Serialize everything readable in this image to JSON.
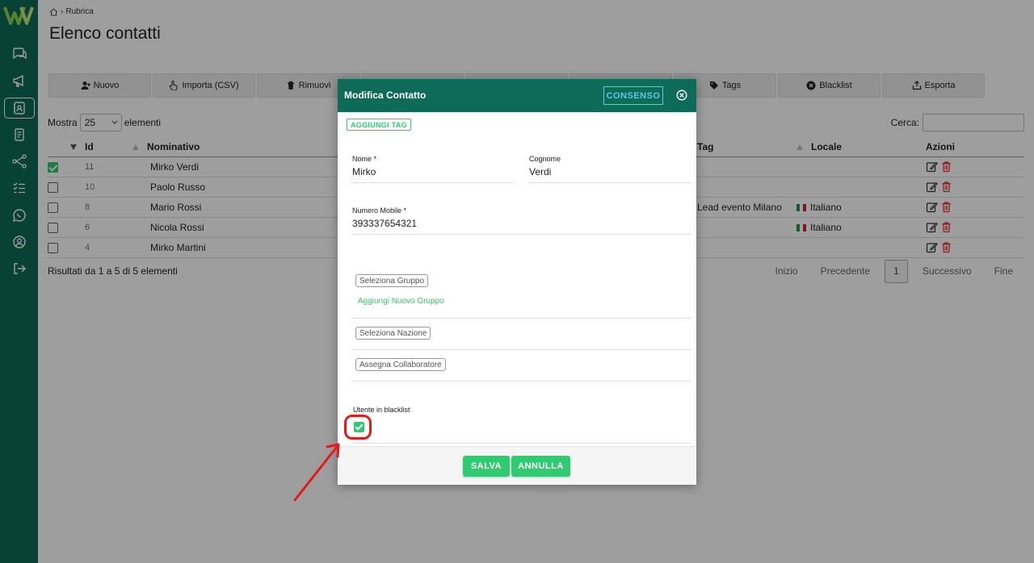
{
  "breadcrumb": {
    "label": "Rubrica"
  },
  "page": {
    "title": "Elenco contatti"
  },
  "toolbar": {
    "buttons": [
      {
        "label": "Nuovo",
        "icon": "user-plus-icon"
      },
      {
        "label": "Importa (CSV)",
        "icon": "hand-pointer-icon"
      },
      {
        "label": "Rimuovi",
        "icon": "trash-icon"
      },
      {
        "label": "",
        "icon": ""
      },
      {
        "label": "",
        "icon": ""
      },
      {
        "label": "",
        "icon": ""
      },
      {
        "label": "Tags",
        "icon": "tag-icon"
      },
      {
        "label": "Blacklist",
        "icon": "x-circle-icon"
      },
      {
        "label": "Esporta",
        "icon": "export-icon"
      }
    ]
  },
  "table_controls": {
    "show_label": "Mostra",
    "show_value": "25",
    "elements_label": "elementi",
    "search_label": "Cerca:"
  },
  "table": {
    "columns": [
      "Id",
      "Nominativo",
      "Tag",
      "Locale",
      "Azioni"
    ],
    "rows": [
      {
        "checked": true,
        "id": "11",
        "name": "Mirko Verdi",
        "tag": "",
        "locale": ""
      },
      {
        "checked": false,
        "id": "10",
        "name": "Paolo Russo",
        "tag": "",
        "locale": ""
      },
      {
        "checked": false,
        "id": "8",
        "name": "Mario Rossi",
        "tag": "Lead evento Milano",
        "locale": "Italiano"
      },
      {
        "checked": false,
        "id": "6",
        "name": "Nicola Rossi",
        "tag": "",
        "locale": "Italiano"
      },
      {
        "checked": false,
        "id": "4",
        "name": "Mirko Martini",
        "tag": "",
        "locale": ""
      }
    ]
  },
  "results": "Risultati da 1 a 5 di 5 elementi",
  "pager": {
    "first": "Inizio",
    "prev": "Precedente",
    "current": "1",
    "next": "Successivo",
    "last": "Fine"
  },
  "modal": {
    "title": "Modifica Contatto",
    "consenso_label": "CONSENSO",
    "add_tag_label": "AGGIUNGI TAG",
    "nome_label": "Nome *",
    "nome_value": "Mirko",
    "cognome_label": "Cognome",
    "cognome_value": "Verdi",
    "mobile_label": "Numero Mobile *",
    "mobile_value": "393337654321",
    "group_chip": "Seleziona Gruppo",
    "add_group_link": "Aggiungi Nuovo Gruppo",
    "nation_chip": "Seleziona Nazione",
    "collab_chip": "Assegna Collaboratore",
    "blacklist_label": "Utente in blacklist",
    "blacklist_checked": true,
    "save_label": "SALVA",
    "cancel_label": "ANNULLA"
  },
  "colors": {
    "brand": "#0e6b57",
    "accent": "#2ecc71",
    "highlight": "#e31b1b",
    "consenso": "#5cc8e6"
  }
}
